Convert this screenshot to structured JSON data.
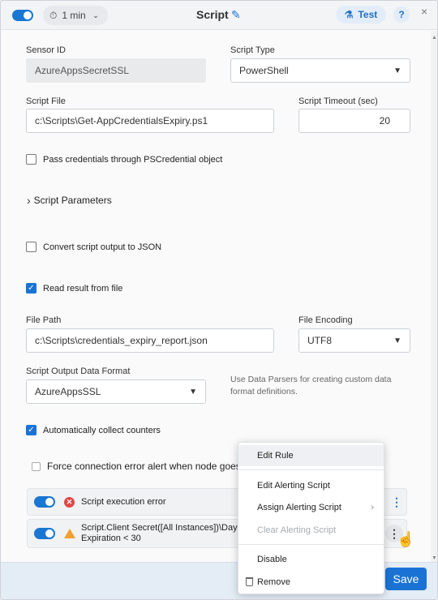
{
  "header": {
    "interval": "1 min",
    "title": "Script",
    "test_label": "Test",
    "help_label": "?",
    "close_label": "×"
  },
  "form": {
    "sensor_id_label": "Sensor ID",
    "sensor_id_value": "AzureAppsSecretSSL",
    "script_type_label": "Script Type",
    "script_type_value": "PowerShell",
    "script_file_label": "Script File",
    "script_file_value": "c:\\Scripts\\Get-AppCredentialsExpiry.ps1",
    "script_timeout_label": "Script Timeout (sec)",
    "script_timeout_value": "20",
    "pass_credentials_label": "Pass credentials through PSCredential object",
    "pass_credentials_checked": false,
    "script_parameters_label": "Script Parameters",
    "convert_json_label": "Convert script output to JSON",
    "convert_json_checked": false,
    "read_result_label": "Read result from file",
    "read_result_checked": true,
    "file_path_label": "File Path",
    "file_path_value": "c:\\Scripts\\credentials_expiry_report.json",
    "file_encoding_label": "File Encoding",
    "file_encoding_value": "UTF8",
    "output_format_label": "Script Output Data Format",
    "output_format_value": "AzureAppsSSL",
    "output_format_hint": "Use Data Parsers for creating custom data format definitions.",
    "auto_collect_label": "Automatically collect counters",
    "auto_collect_checked": true,
    "force_alert_label": "Force connection error alert when node goes"
  },
  "rules": [
    {
      "name": "Script execution error",
      "severity": "error",
      "enabled": true
    },
    {
      "name": "Script.Client Secret([All Instances])\\Days",
      "name_line2": "Expiration < 30",
      "severity": "warning",
      "enabled": true
    }
  ],
  "context_menu": {
    "items": [
      {
        "label": "Edit Rule",
        "state": "hover"
      },
      {
        "label": "Edit Alerting Script",
        "state": "normal"
      },
      {
        "label": "Assign Alerting Script",
        "state": "normal",
        "submenu": true
      },
      {
        "label": "Clear Alerting Script",
        "state": "disabled"
      },
      {
        "label": "Disable",
        "state": "normal"
      },
      {
        "label": "Remove",
        "state": "normal",
        "icon": "trash-icon"
      }
    ]
  },
  "footer": {
    "save_label": "Save"
  },
  "colors": {
    "accent": "#1a73d4",
    "error": "#e04848",
    "warning": "#f0a030"
  }
}
